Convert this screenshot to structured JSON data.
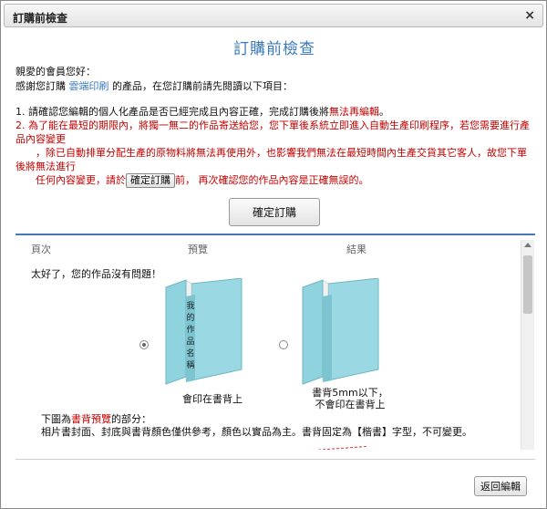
{
  "window": {
    "title": "訂購前檢查",
    "close_label": "×"
  },
  "heading": "訂購前檢查",
  "greeting": "親愛的會員您好：",
  "thanks": {
    "prefix": "感謝您訂購 ",
    "brand": "雲端印刷",
    "suffix": " 的產品，在您訂購前請先閱讀以下項目："
  },
  "items": {
    "item1_prefix": "1. 請確認您編輯的個人化產品是否已經完成且內容正確，完成訂購後將",
    "item1_red": "無法再編輯",
    "item1_suffix": "。",
    "item2_line1": "2. 為了能在最短的期限內，將獨一無二的作品寄送給您，您下單後系統立即進入自動生產印刷程序，若您需要進行產品內容變更",
    "item2_line2": "　　，除已自動排單分配生產的原物料將無法再使用外，也影響我們無法在最短時間內生產交貨其它客人，故您下單後將無法進行",
    "item2_line3_prefix": "　　任何內容變更，請於",
    "item2_inline_btn": "確定訂購",
    "item2_line3_suffix": "前， 再次確認您的作品內容是正確無誤的。"
  },
  "confirm_button": "確定訂購",
  "preview": {
    "columns": [
      "頁次",
      "預覽",
      "結果"
    ],
    "ok_message": "太好了，您的作品沒有問題！",
    "spine_text": [
      "我",
      "的",
      "作",
      "品",
      "名",
      "稱"
    ],
    "caption_left": "會印在書背上",
    "caption_right_1": "書背5mm以下，",
    "caption_right_2": "不會印在書背上",
    "note_prefix": "下圖為",
    "note_red": "書背預覽",
    "note_suffix": "的部分：",
    "note2": "相片書封面、封底與書背顏色僅供參考，顏色以實品為主。書背固定為【楷書】字型，不可變更。",
    "book_color": "#8fd3de"
  },
  "back_button": "返回編輯"
}
